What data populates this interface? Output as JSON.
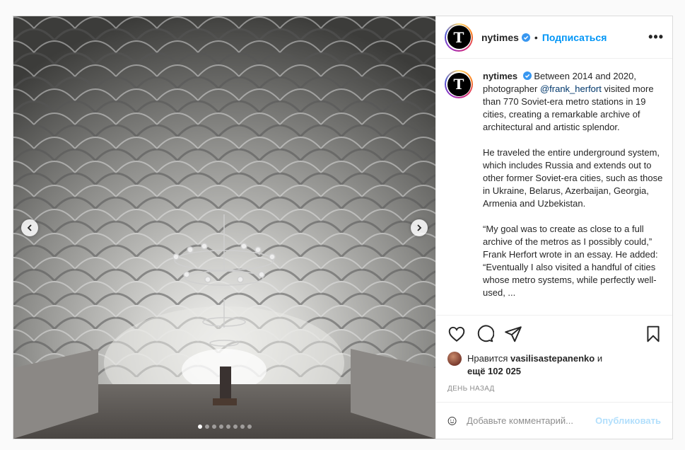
{
  "post": {
    "username": "nytimes",
    "logo_glyph": "T",
    "bullet": "•",
    "follow_label": "Подписаться",
    "more_label": "•••",
    "carousel_dots": 8,
    "active_dot": 0
  },
  "caption": {
    "username": "nytimes",
    "paragraph1_a": "Between 2014 and 2020, photographer ",
    "mention": "@frank_herfort",
    "paragraph1_b": " visited more than 770 Soviet-era metro stations in 19 cities, creating a remarkable archive of architectural and artistic splendor.",
    "paragraph2": "He traveled the entire underground system, which includes Russia and extends out to other former Soviet-era cities, such as those in Ukraine, Belarus, Azerbaijan, Georgia, Armenia and Uzbekistan.",
    "paragraph3": "“My goal was to create as close to a full archive of the metros as I possibly could,” Frank Herfort wrote in an essay. He added: “Eventually I also visited a handful of cities whose metro systems, while perfectly well-used, ..."
  },
  "likes": {
    "prefix": "Нравится ",
    "user": "vasilisastepanenko",
    "and": " и",
    "count": "ещё 102 025"
  },
  "timestamp": "ДЕНЬ НАЗАД",
  "comment": {
    "placeholder": "Добавьте комментарий...",
    "publish_label": "Опубликовать"
  },
  "icons": {
    "like": "heart-icon",
    "comment": "comment-icon",
    "share": "paper-plane-icon",
    "save": "bookmark-icon",
    "emoji": "smile-icon",
    "prev": "chevron-left-icon",
    "next": "chevron-right-icon"
  },
  "colors": {
    "accent": "#0095f6",
    "publish_disabled": "#b2dffc",
    "mention": "#00376b",
    "verified": "#3897f0"
  }
}
